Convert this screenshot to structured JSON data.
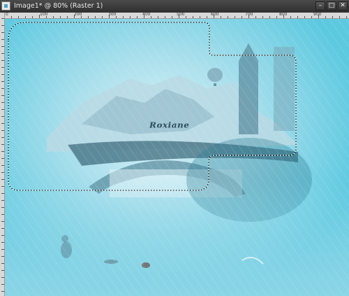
{
  "window": {
    "title": "Image1* @  80% (Raster 1)",
    "minimize_glyph": "–",
    "maximize_glyph": "□",
    "close_glyph": "✕"
  },
  "ruler": {
    "labels": [
      "0",
      "100",
      "200",
      "300",
      "400",
      "500",
      "600",
      "700",
      "800",
      "900"
    ]
  },
  "canvas": {
    "watermark_text": "Roxiane",
    "colors": {
      "sky": "#5cc9e0",
      "mist": "#bfe9f3",
      "deep": "#2f7f96"
    },
    "selection": "marching-ants"
  }
}
